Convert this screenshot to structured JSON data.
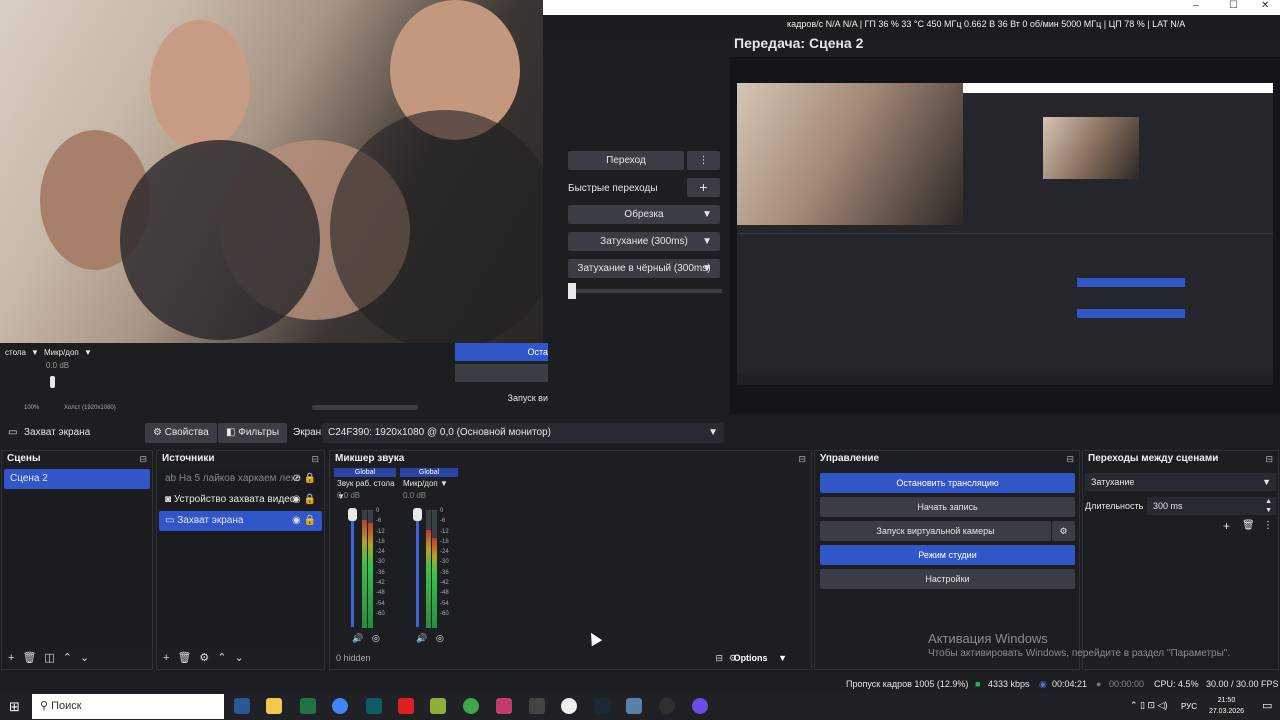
{
  "app": {
    "stats_line": "кадров/с N/A N/A | ГП 36 % 33 °C 450 МГц 0.662 В 36 Вт 0 об/мин 5000 МГц | ЦП 78 % | LAT N/A",
    "preview_title": "Передача: Сцена 2",
    "window_controls": [
      "–",
      "☐",
      "✕"
    ]
  },
  "transitions_mini": {
    "transition_btn": "Переход",
    "quick_transitions": "Быстрые переходы",
    "cut_btn": "Обрезка",
    "fade_btn": "Затухание (300ms)",
    "fade_black_btn": "Затухание в чёрный (300ms)"
  },
  "left_mini_mixer": {
    "ch1_name": "стола",
    "ch2_name": "Микр/доп",
    "db_value": "0.0 dB",
    "zoom": "100%",
    "canvas": "Холст (1920x1080)",
    "btn_stop": "Оста",
    "btn_record": "Запуск ви"
  },
  "source_toolbar": {
    "source_name": "Захват экрана",
    "properties_btn": "Свойства",
    "filters_btn": "Фильтры",
    "screen_label": "Экран",
    "screen_value": "C24F390: 1920x1080 @ 0,0 (Основной монитор)"
  },
  "scenes": {
    "title": "Сцены",
    "items": [
      "Сцена 2"
    ]
  },
  "sources": {
    "title": "Источники",
    "items": [
      {
        "label": "На 5 лайков харкаем лехе",
        "icon": "text-icon"
      },
      {
        "label": "Устройство захвата видео",
        "icon": "camera-icon"
      },
      {
        "label": "Захват экрана",
        "icon": "monitor-icon"
      }
    ]
  },
  "mixer": {
    "title": "Микшер звука",
    "channels": [
      {
        "global": "Global",
        "name": "Звук раб. стола",
        "db": "0.0 dB"
      },
      {
        "global": "Global",
        "name": "Микр/доп",
        "db": "0.0 dB"
      }
    ],
    "scale": [
      "0",
      "-6",
      "-12",
      "-18",
      "-24",
      "-30",
      "-36",
      "-42",
      "-48",
      "-54",
      "-60"
    ],
    "hidden": "0 hidden",
    "options": "Options"
  },
  "controls": {
    "title": "Управление",
    "stop_stream": "Остановить трансляцию",
    "start_record": "Начать запись",
    "virtual_cam": "Запуск виртуальной камеры",
    "studio_mode": "Режим студии",
    "settings": "Настройки"
  },
  "scene_transitions": {
    "title": "Переходы между сценами",
    "type": "Затухание",
    "duration_label": "Длительность",
    "duration_value": "300 ms"
  },
  "activation": {
    "line1": "Активация Windows",
    "line2": "Чтобы активировать Windows, перейдите в раздел \"Параметры\"."
  },
  "status": {
    "dropped": "Пропуск кадров 1005 (12.9%)",
    "bitrate": "4333 kbps",
    "stream_time": "00:04:21",
    "rec_time": "00:00:00",
    "cpu": "CPU: 4.5%",
    "fps": "30.00 / 30.00 FPS"
  },
  "taskbar": {
    "search": "Поиск",
    "lang": "РУС",
    "time": "21:50",
    "date": "27.03.2026"
  }
}
